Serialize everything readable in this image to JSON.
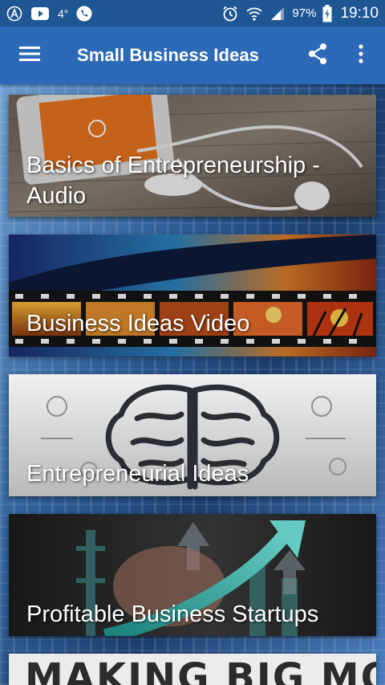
{
  "status_bar": {
    "temperature": "4°",
    "battery_percent": "97%",
    "time": "19:10",
    "icons": [
      "assistant-icon",
      "youtube-icon",
      "phone-icon",
      "alarm-icon",
      "wifi-icon",
      "signal-icon",
      "battery-charging-icon"
    ]
  },
  "app_bar": {
    "title": "Small Business Ideas",
    "icons": [
      "menu-icon",
      "share-icon",
      "more-vert-icon"
    ]
  },
  "cards": [
    {
      "title": "Basics of Entrepreneurship - Audio",
      "art": "phone-with-earphones"
    },
    {
      "title": "Business Ideas Video",
      "art": "film-strip-sunsets"
    },
    {
      "title": "Entrepreneurial Ideas",
      "art": "brain-doodle"
    },
    {
      "title": "Profitable Business Startups",
      "art": "rising-arrow-chart"
    },
    {
      "title": "MAKING BIG MONEY",
      "art": "banner-text"
    }
  ],
  "colors": {
    "status_bar": "#1e5794",
    "app_bar": "#2c6ab8",
    "card_text": "#ffffff"
  }
}
